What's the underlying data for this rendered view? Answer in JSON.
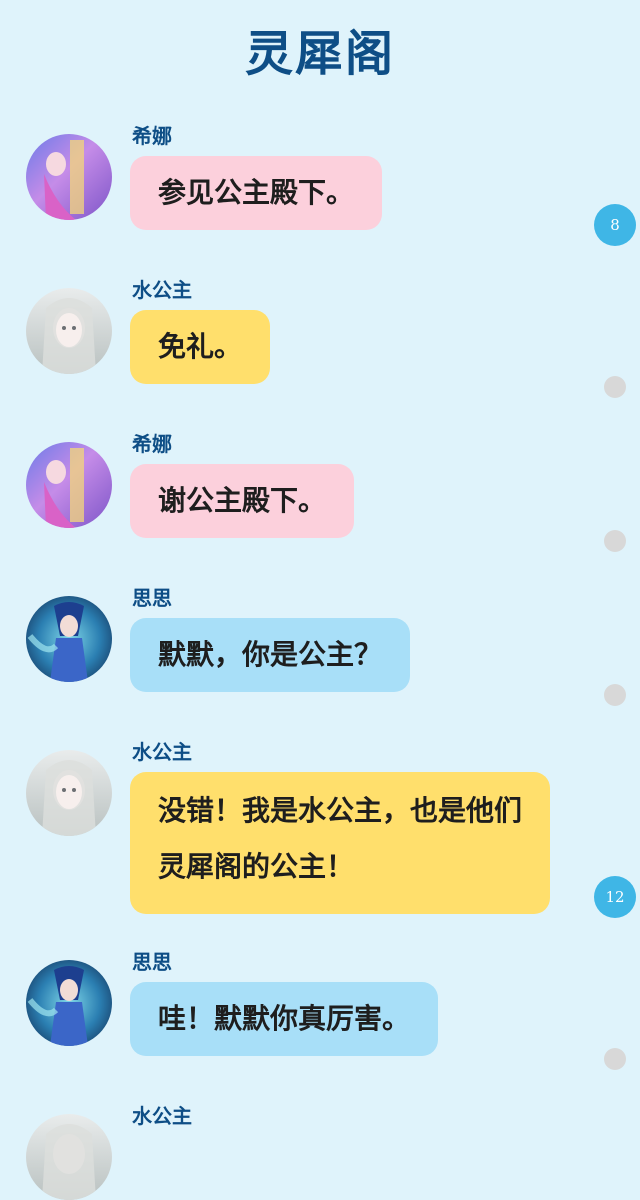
{
  "title": "灵犀阁",
  "colors": {
    "background": "#dff3fb",
    "title": "#0e4e86",
    "badge": "#3fb6e6",
    "bubble_pink": "#fcd0dc",
    "bubble_yellow": "#ffdf6c",
    "bubble_blue": "#a8dff8"
  },
  "messages": [
    {
      "sender": "希娜",
      "avatar": "xina-avatar",
      "text": "参见公主殿下。",
      "color": "pink"
    },
    {
      "sender": "水公主",
      "avatar": "water-princess-avatar",
      "text": "免礼。",
      "color": "yellow"
    },
    {
      "sender": "希娜",
      "avatar": "xina-avatar",
      "text": "谢公主殿下。",
      "color": "pink"
    },
    {
      "sender": "思思",
      "avatar": "sisi-avatar",
      "text": "默默，你是公主？",
      "color": "blue"
    },
    {
      "sender": "水公主",
      "avatar": "water-princess-avatar",
      "text": "没错！我是水公主，也是他们灵犀阁的公主！",
      "color": "yellow"
    },
    {
      "sender": "思思",
      "avatar": "sisi-avatar",
      "text": "哇！默默你真厉害。",
      "color": "blue"
    },
    {
      "sender": "水公主",
      "avatar": "water-princess-avatar",
      "text": "",
      "color": "yellow"
    }
  ],
  "badges": [
    {
      "label": "8"
    },
    {
      "label": "12"
    }
  ]
}
